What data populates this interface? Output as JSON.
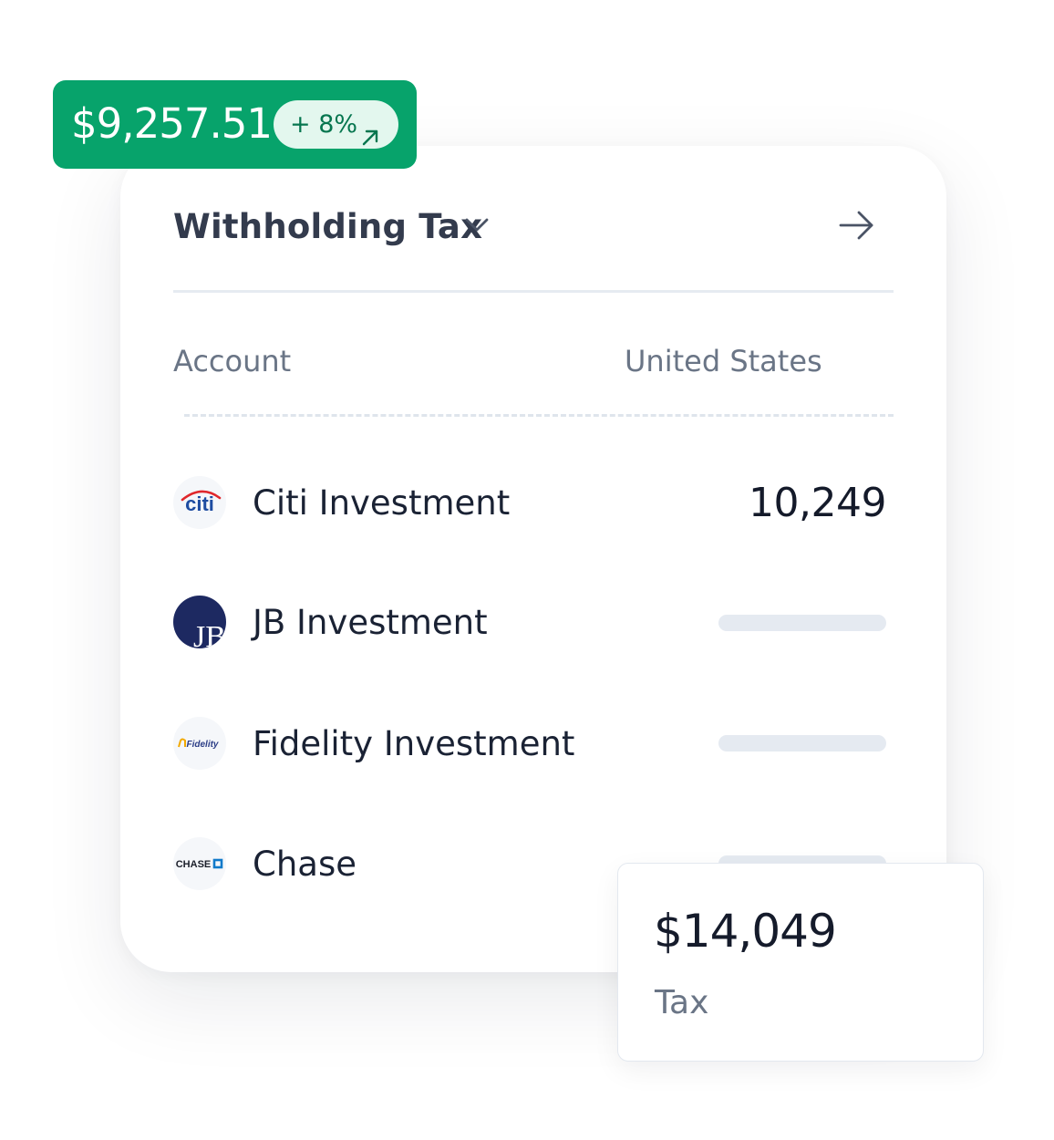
{
  "summary_badge": {
    "amount": "$9,257.51",
    "change": "+ 8%"
  },
  "card": {
    "title": "Withholding Tax"
  },
  "table": {
    "columns": [
      "Account",
      "United States"
    ],
    "rows": [
      {
        "name": "Citi Investment",
        "value": "10,249",
        "logo_icon": "citi-logo"
      },
      {
        "name": "JB Investment",
        "value": null,
        "logo_icon": "jb-logo"
      },
      {
        "name": "Fidelity Investment",
        "value": null,
        "logo_icon": "fidelity-logo"
      },
      {
        "name": "Chase",
        "value": null,
        "logo_icon": "chase-logo"
      }
    ]
  },
  "tax_card": {
    "amount": "$14,049",
    "label": "Tax"
  },
  "logos": {
    "citi": "citi",
    "fidelity": "Fidelity",
    "chase": "CHASE",
    "jb": "JB"
  },
  "colors": {
    "accent_green": "#07a36b",
    "pill_bg": "#e3f7ee",
    "pill_text": "#06764f",
    "title_text": "#333b4d",
    "muted_text": "#6a7586",
    "placeholder": "#e5eaf1"
  },
  "icons": [
    "arrow-up-right-icon",
    "chevron-down-icon",
    "arrow-right-icon"
  ]
}
